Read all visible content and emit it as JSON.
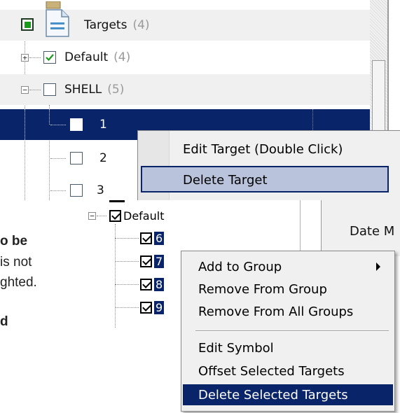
{
  "upper_tree": {
    "targets": {
      "label": "Targets",
      "count": "(4)"
    },
    "default": {
      "label": "Default",
      "count": "(4)"
    },
    "shell": {
      "label": "SHELL",
      "count": "(5)"
    },
    "children": [
      "1",
      "2",
      "3"
    ]
  },
  "upper_menu": {
    "items": [
      "Edit Target (Double Click)",
      "Delete Target"
    ],
    "highlighted_index": 1
  },
  "lower_tree": {
    "group_label": "Default",
    "children": [
      "6",
      "7",
      "8",
      "9"
    ]
  },
  "date_header": "Date M",
  "lower_menu": {
    "items": [
      "Add to Group",
      "Remove From Group",
      "Remove From All Groups",
      "Edit Symbol",
      "Offset Selected Targets",
      "Delete Selected Targets"
    ],
    "highlighted_index": 5
  },
  "left_fragments": [
    "o be",
    "is not",
    "ghted.",
    "d"
  ],
  "colors": {
    "selection": "#0a246a",
    "menu_bg": "#f0f0f0",
    "menu_hover": "#b9c4dc",
    "check_green": "#1a9a1a"
  },
  "icons": [
    "document-icon",
    "expand-icon",
    "collapse-icon",
    "checkbox-checked-icon",
    "submenu-arrow-icon"
  ]
}
